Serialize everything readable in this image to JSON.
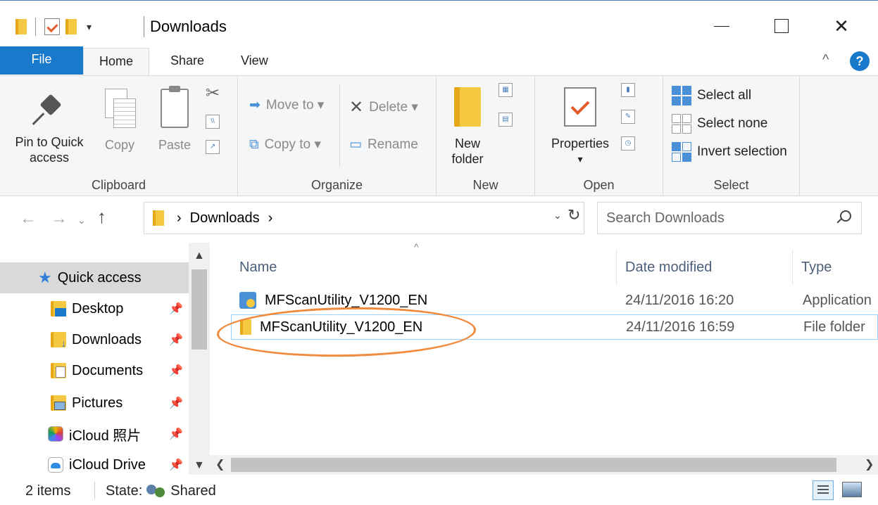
{
  "window": {
    "title": "Downloads",
    "qat_dropdown": "▾",
    "minimize_label": "",
    "maximize_label": "",
    "close_label": "✕"
  },
  "tabs": [
    {
      "label": "File"
    },
    {
      "label": "Home"
    },
    {
      "label": "Share"
    },
    {
      "label": "View"
    }
  ],
  "ribbon": {
    "clipboard": {
      "label": "Clipboard",
      "pin_label_1": "Pin to Quick",
      "pin_label_2": "access",
      "copy_label": "Copy",
      "paste_label": "Paste"
    },
    "organize": {
      "label": "Organize",
      "move_to": "Move to ▾",
      "copy_to": "Copy to ▾",
      "delete": "Delete ▾",
      "rename": "Rename"
    },
    "new": {
      "label": "New",
      "new_folder_1": "New",
      "new_folder_2": "folder"
    },
    "open": {
      "label": "Open",
      "properties": "Properties",
      "properties_dd": "▾"
    },
    "select": {
      "label": "Select",
      "select_all": "Select all",
      "select_none": "Select none",
      "invert": "Invert selection"
    }
  },
  "address": {
    "path": "Downloads",
    "search_placeholder": "Search Downloads"
  },
  "nav_pane": {
    "items": [
      {
        "label": "Quick access"
      },
      {
        "label": "Desktop"
      },
      {
        "label": "Downloads"
      },
      {
        "label": "Documents"
      },
      {
        "label": "Pictures"
      },
      {
        "label": "iCloud 照片"
      },
      {
        "label": "iCloud Drive"
      }
    ]
  },
  "columns": {
    "name": "Name",
    "date": "Date modified",
    "type": "Type"
  },
  "files": [
    {
      "name": "MFScanUtility_V1200_EN",
      "date": "24/11/2016 16:20",
      "type": "Application"
    },
    {
      "name": "MFScanUtility_V1200_EN",
      "date": "24/11/2016 16:59",
      "type": "File folder"
    }
  ],
  "status": {
    "items": "2 items",
    "state_label": "State:",
    "state_value": "Shared"
  },
  "colors": {
    "accent": "#1979ca",
    "highlight_ellipse": "#f08a3c",
    "selection_border": "#99d1ff"
  }
}
